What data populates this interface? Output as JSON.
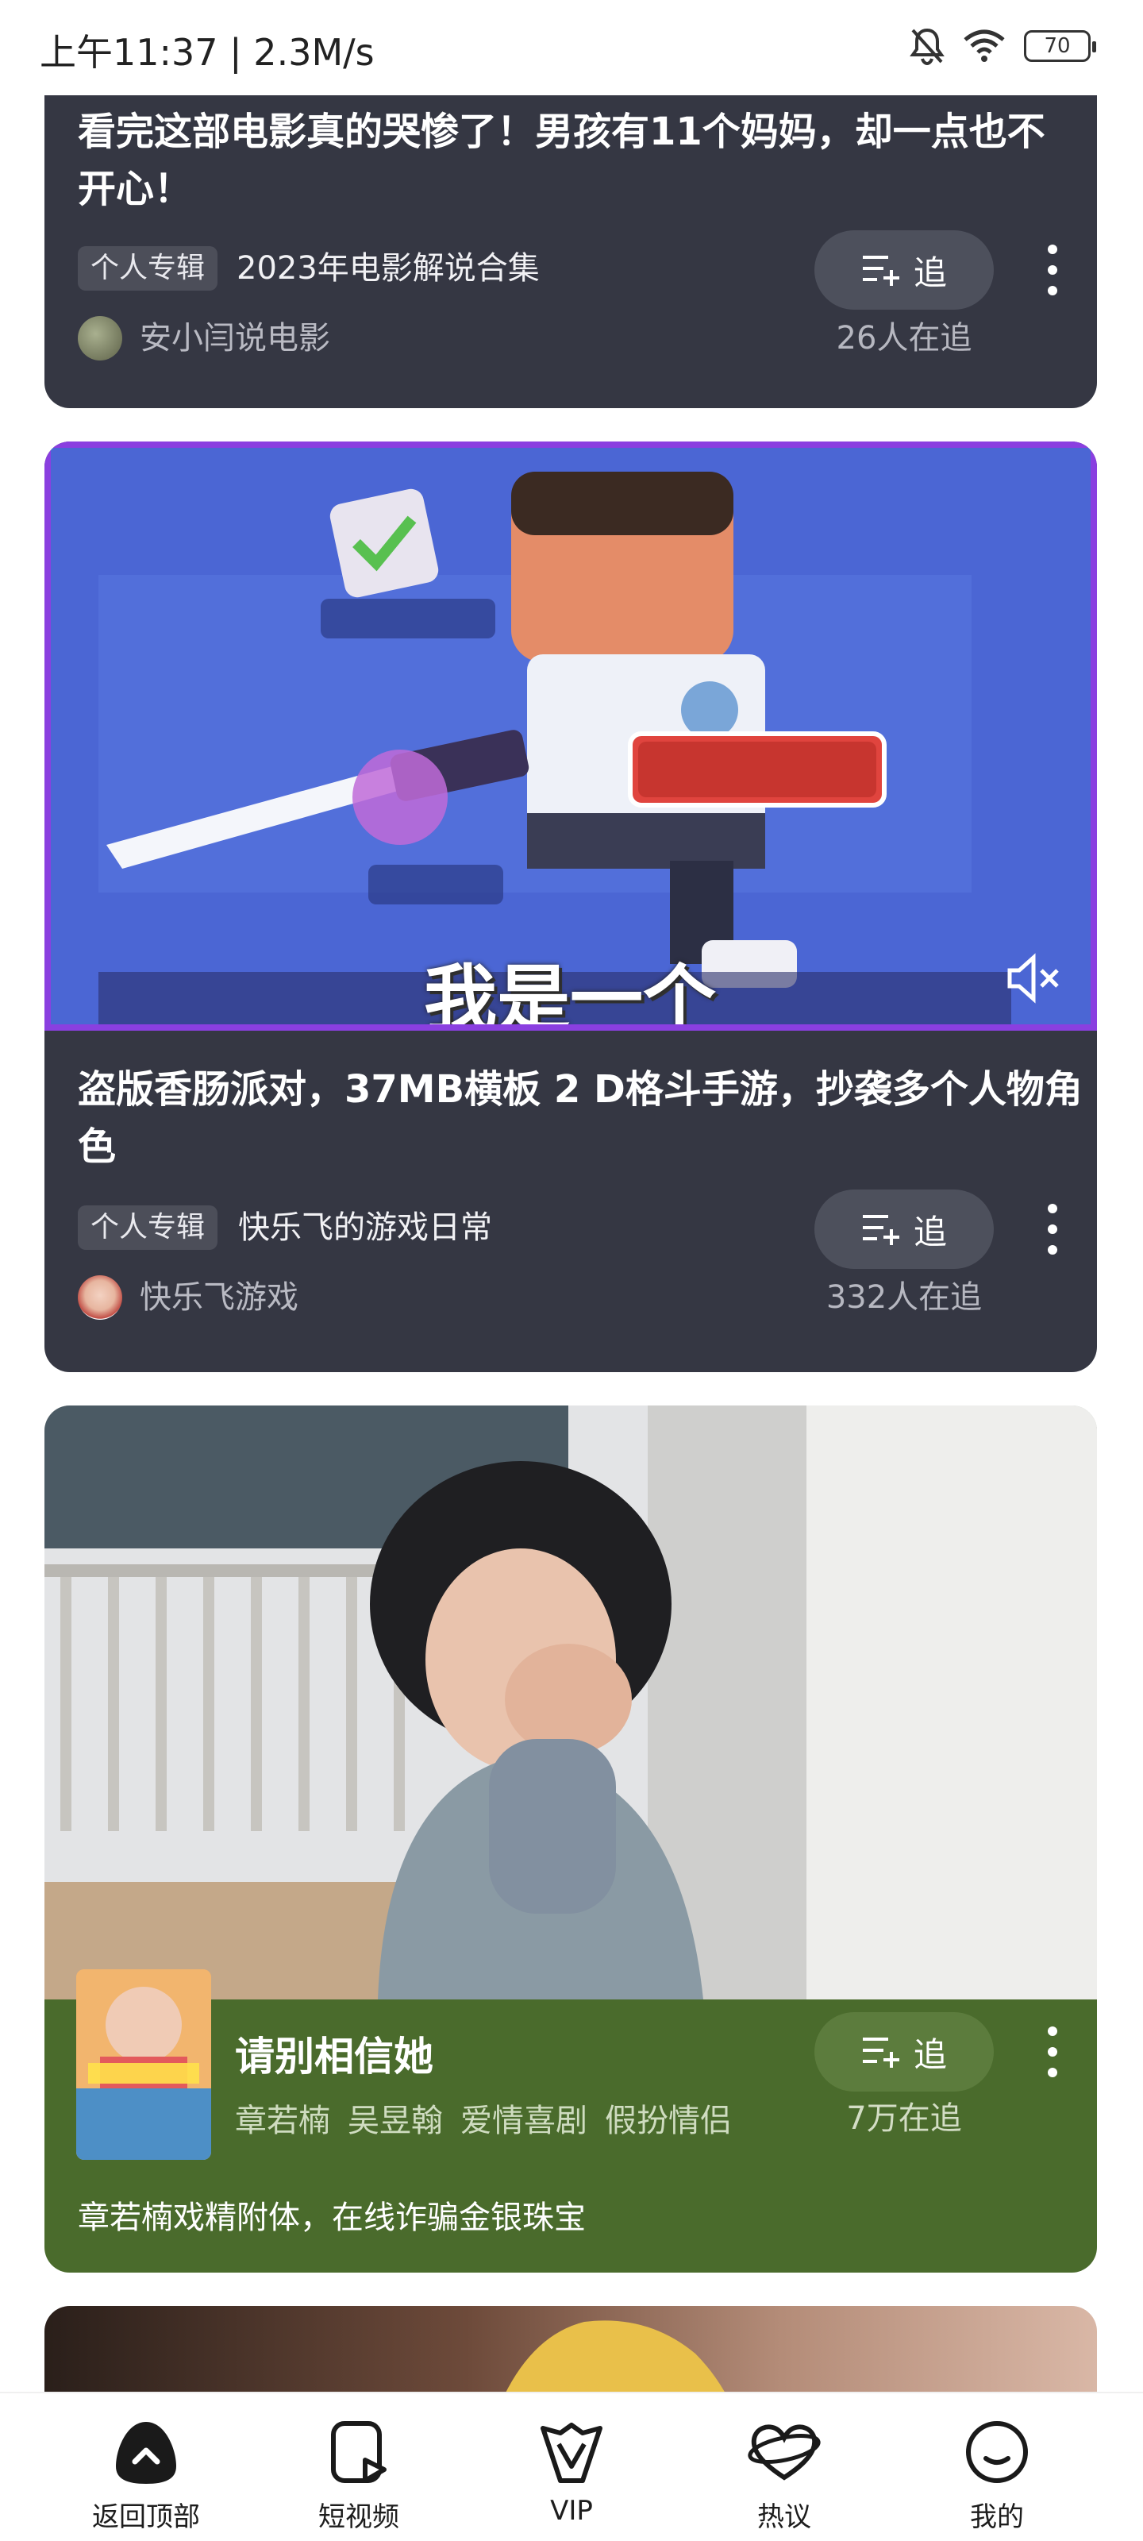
{
  "status_bar": {
    "time": "上午11:37 | 2.3M/s",
    "battery": "70"
  },
  "cards": {
    "card1": {
      "title_line1": "看完这部电影真的哭惨了！男孩有11个妈妈，却一点也不",
      "title_line2": "开心！",
      "tag": "个人专辑",
      "collection": "2023年电影解说合集",
      "author": "安小闫说电影",
      "follow_label": "追",
      "follow_count": "26人在追"
    },
    "card2": {
      "subtitle": "我是一个",
      "title_line1": "盗版香肠派对，37MB横板 2 D格斗手游，抄袭多个人物角",
      "title_line2": "色",
      "tag": "个人专辑",
      "collection": "快乐飞的游戏日常",
      "author": "快乐飞游戏",
      "follow_label": "追",
      "follow_count": "332人在追"
    },
    "card3": {
      "title": "请别相信她",
      "tags": [
        "章若楠",
        "吴昱翰",
        "爱情喜剧",
        "假扮情侣"
      ],
      "follow_label": "追",
      "follow_count": "7万在追",
      "description": "章若楠戏精附体，在线诈骗金银珠宝"
    }
  },
  "bottom_nav": [
    {
      "label": "返回顶部",
      "icon": "back-to-top-icon"
    },
    {
      "label": "短视频",
      "icon": "short-video-icon"
    },
    {
      "label": "VIP",
      "icon": "vip-icon"
    },
    {
      "label": "热议",
      "icon": "discussion-icon"
    },
    {
      "label": "我的",
      "icon": "profile-icon"
    }
  ],
  "colors": {
    "card_dark": "#353743",
    "card_green": "#4a6b2c",
    "video_border": "#8a3fe0"
  }
}
